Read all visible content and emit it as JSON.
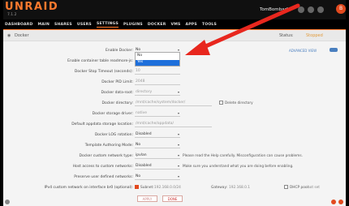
{
  "app": {
    "logo": "UNRAID",
    "version": "7.1.2",
    "user": "TomBombadil",
    "avatar_letter": "B"
  },
  "colors": {
    "accent": "#ff7a2e",
    "arrow": "#e8271e",
    "select_highlight": "#1e6fdb",
    "status_stopped": "#e29a3b"
  },
  "nav": {
    "tabs": [
      "DASHBOARD",
      "MAIN",
      "SHARES",
      "USERS",
      "SETTINGS",
      "PLUGINS",
      "DOCKER",
      "VMS",
      "APPS",
      "TOOLS"
    ],
    "active": "SETTINGS"
  },
  "section": {
    "title": "Docker",
    "status_label": "Status:",
    "status_value": "Stopped"
  },
  "advanced_view": "ADVANCED VIEW",
  "form": {
    "enable_docker": {
      "label": "Enable Docker:",
      "value": "No",
      "options": [
        "No",
        "Yes"
      ],
      "highlighted": "Yes"
    },
    "readmore": {
      "label": "Enable container table readmore-js:"
    },
    "stop_timeout": {
      "label": "Docker Stop Timeout (seconds):",
      "value": "10"
    },
    "pid_limit": {
      "label": "Docker PID Limit:",
      "value": "2048"
    },
    "data_root": {
      "label": "Docker data-root:",
      "value": "directory"
    },
    "directory": {
      "label": "Docker directory:",
      "value": "/mnt/cache/system/docker/",
      "aux": "Delete directory"
    },
    "storage_driver": {
      "label": "Docker storage driver:",
      "value": "native"
    },
    "appdata": {
      "label": "Default appdata storage location:",
      "value": "/mnt/cache/appdata/"
    },
    "log_rotation": {
      "label": "Docker LOG rotation:",
      "value": "Disabled"
    },
    "template_mode": {
      "label": "Template Authoring Mode:",
      "value": "No"
    },
    "network_type": {
      "label": "Docker custom network type:",
      "value": "ipvlan",
      "help": "Please read the Help carefully. Misconfiguration can cause problems."
    },
    "host_access": {
      "label": "Host access to custom networks:",
      "value": "Disabled",
      "help": "Make sure you understand what you are doing before enabling."
    },
    "preserve": {
      "label": "Preserve user defined networks:",
      "value": "No"
    },
    "ipv4": {
      "label": "IPv4 custom network on interface br0 (optional):",
      "subnet_label": "Subnet:",
      "subnet": "192.168.0.0/24",
      "gateway_label": "Gateway:",
      "gateway": "192.168.0.1",
      "dhcp_label": "DHCP pool:",
      "dhcp_value": "not set"
    }
  },
  "buttons": {
    "apply": "APPLY",
    "done": "DONE"
  }
}
